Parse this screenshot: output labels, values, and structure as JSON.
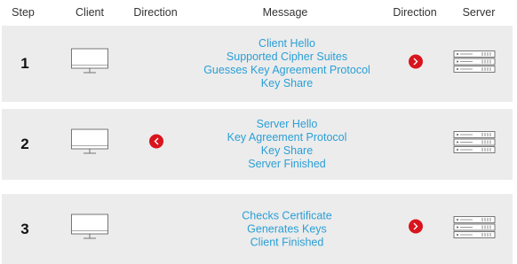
{
  "headers": {
    "step": "Step",
    "client": "Client",
    "direction_left": "Direction",
    "message": "Message",
    "direction_right": "Direction",
    "server": "Server"
  },
  "colors": {
    "row_bg": "#ececec",
    "message_text": "#2a9fd6",
    "arrow_fill": "#d9141c",
    "icon_stroke": "#555555"
  },
  "rows": [
    {
      "step": "1",
      "direction": "client-to-server",
      "arrow_icon": "chevron-right-icon",
      "messages": [
        "Client Hello",
        "Supported Cipher Suites",
        "Guesses Key Agreement Protocol",
        "Key Share"
      ]
    },
    {
      "step": "2",
      "direction": "server-to-client",
      "arrow_icon": "chevron-left-icon",
      "messages": [
        "Server Hello",
        "Key Agreement Protocol",
        "Key Share",
        "Server Finished"
      ]
    },
    {
      "step": "3",
      "direction": "client-to-server",
      "arrow_icon": "chevron-right-icon",
      "messages": [
        "Checks Certificate",
        "Generates Keys",
        "Client Finished"
      ]
    }
  ]
}
